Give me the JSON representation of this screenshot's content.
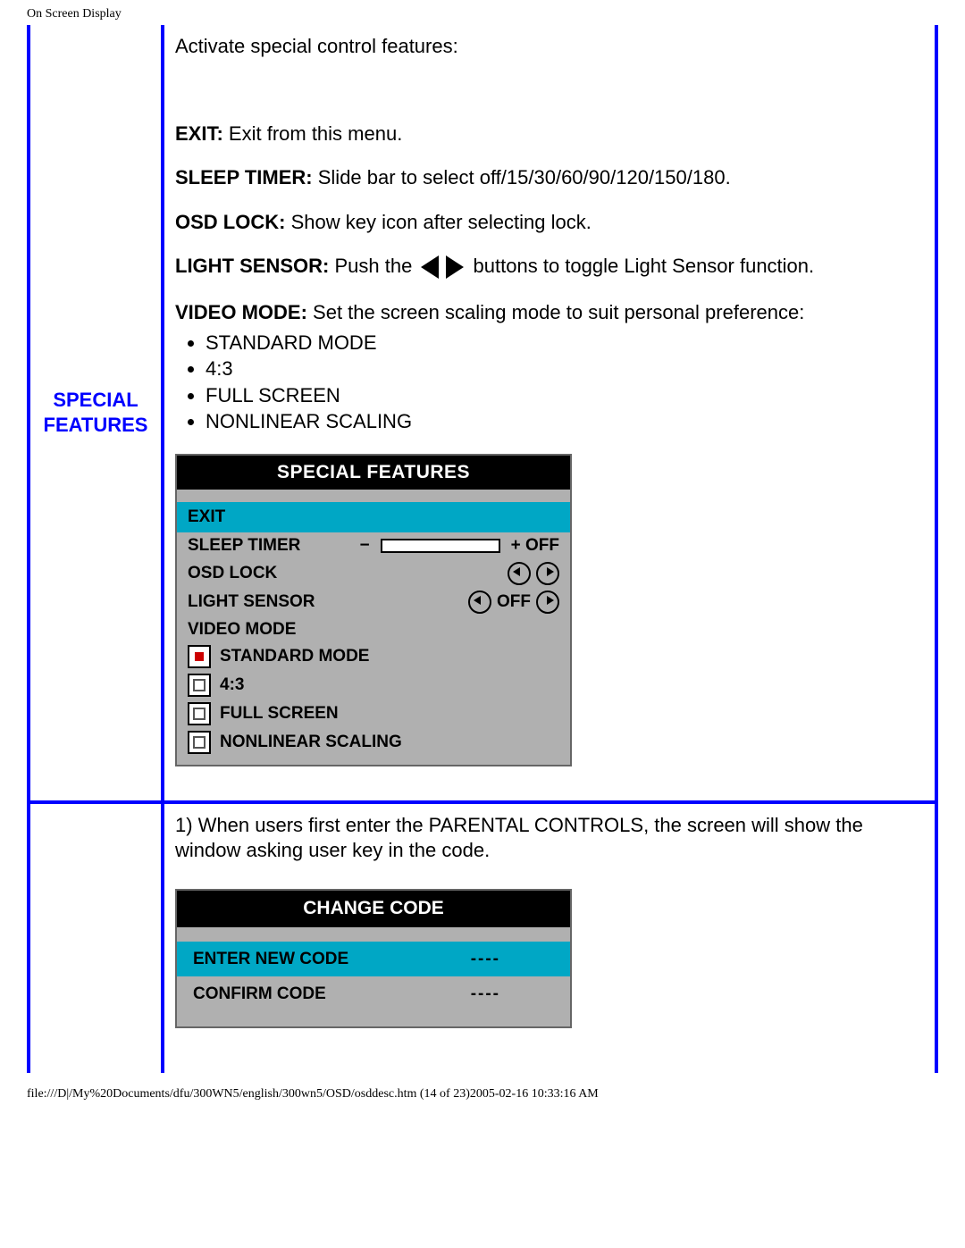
{
  "header": "On Screen Display",
  "section": {
    "title_lines": [
      "SPECIAL",
      "FEATURES"
    ],
    "intro": "Activate special control features:",
    "defs": {
      "exit": {
        "term": "EXIT:",
        "desc": "Exit from this menu."
      },
      "sleep": {
        "term": "SLEEP TIMER:",
        "desc": "Slide bar to select off/15/30/60/90/120/150/180."
      },
      "osdlock": {
        "term": "OSD LOCK:",
        "desc": "Show key icon after selecting lock."
      },
      "lightsensor": {
        "term": "LIGHT SENSOR:",
        "before": "Push the ",
        "after": " buttons to toggle Light Sensor function."
      },
      "videomode": {
        "term": "VIDEO MODE:",
        "desc": "Set the screen scaling mode to suit personal preference:"
      }
    },
    "video_modes": [
      "STANDARD MODE",
      "4:3",
      "FULL SCREEN",
      "NONLINEAR SCALING"
    ]
  },
  "osd_panel": {
    "title": "SPECIAL FEATURES",
    "exit": "EXIT",
    "sleep_label": "SLEEP TIMER",
    "sleep_minus": "−",
    "sleep_plus": "+ OFF",
    "osdlock_label": "OSD LOCK",
    "light_label": "LIGHT SENSOR",
    "light_value": "OFF",
    "videomode_label": "VIDEO MODE",
    "opts": [
      {
        "label": "STANDARD MODE",
        "selected": true
      },
      {
        "label": "4:3",
        "selected": false
      },
      {
        "label": "FULL SCREEN",
        "selected": false
      },
      {
        "label": "NONLINEAR SCALING",
        "selected": false
      }
    ]
  },
  "parental": {
    "intro": "1) When users first enter the PARENTAL CONTROLS, the screen will show the window asking user key in the code.",
    "panel": {
      "title": "CHANGE CODE",
      "enter": "ENTER NEW CODE",
      "confirm": "CONFIRM CODE",
      "dashes": "----"
    }
  },
  "footer": "file:///D|/My%20Documents/dfu/300WN5/english/300wn5/OSD/osddesc.htm (14 of 23)2005-02-16 10:33:16 AM"
}
